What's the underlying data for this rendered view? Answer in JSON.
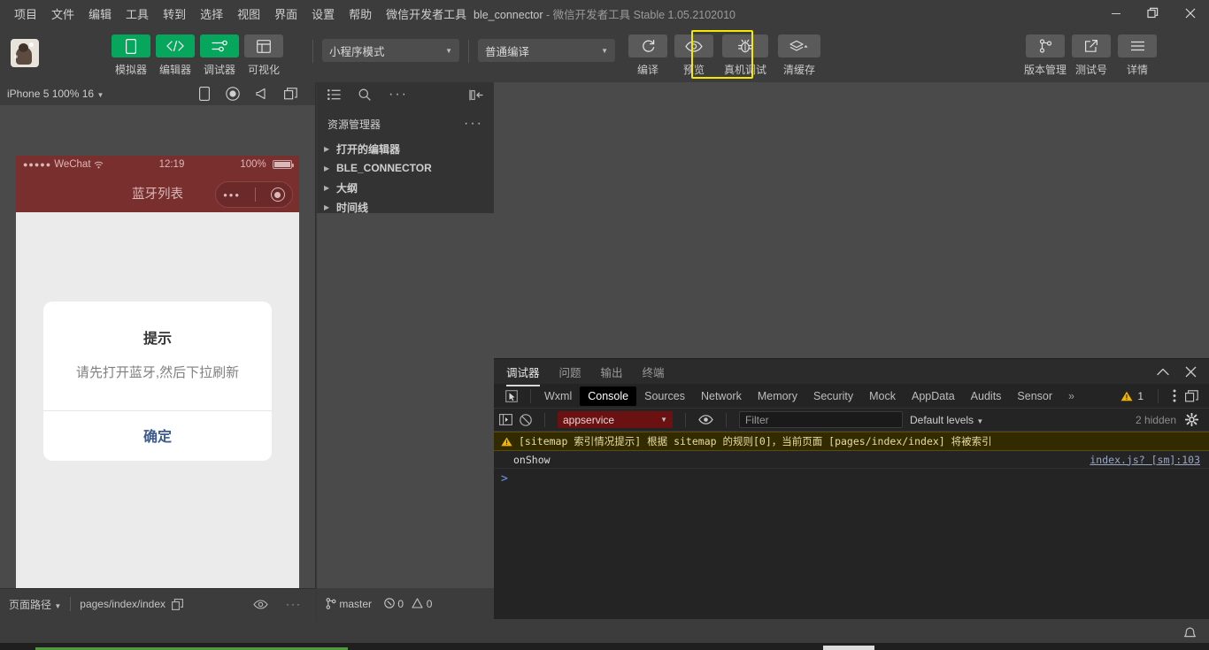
{
  "titlebar": {
    "menus": [
      "项目",
      "文件",
      "编辑",
      "工具",
      "转到",
      "选择",
      "视图",
      "界面",
      "设置",
      "帮助",
      "微信开发者工具"
    ],
    "project_name": "ble_connector",
    "title_suffix": " - 微信开发者工具 Stable 1.05.2102010",
    "window_controls": [
      "minimize-icon",
      "restore-icon",
      "close-icon"
    ]
  },
  "toolbar": {
    "left_buttons": [
      {
        "label": "模拟器",
        "icon": "phone-icon",
        "active": true
      },
      {
        "label": "编辑器",
        "icon": "code-icon",
        "active": true
      },
      {
        "label": "调试器",
        "icon": "sliders-icon",
        "active": true
      },
      {
        "label": "可视化",
        "icon": "layout-icon",
        "active": false
      }
    ],
    "mode_select": "小程序模式",
    "compile_select": "普通编译",
    "mid_buttons": [
      {
        "label": "编译",
        "icon": "refresh-icon",
        "highlighted": false
      },
      {
        "label": "预览",
        "icon": "eye-icon",
        "highlighted": false
      },
      {
        "label": "真机调试",
        "icon": "bug-icon",
        "highlighted": true
      },
      {
        "label": "清缓存",
        "icon": "layers-icon",
        "highlighted": false
      }
    ],
    "right_buttons": [
      {
        "label": "版本管理",
        "icon": "branch-icon"
      },
      {
        "label": "测试号",
        "icon": "external-link-icon"
      },
      {
        "label": "详情",
        "icon": "hamburger-icon"
      }
    ],
    "highlight_color": "#f5e900",
    "accent_green": "#07a65d"
  },
  "simulator": {
    "device": "iPhone 5 100% 16",
    "head_icons": [
      "rotate-device-icon",
      "record-icon",
      "volume-icon",
      "multi-window-icon"
    ],
    "phone": {
      "carrier": "WeChat",
      "signal_dots": "●●●●●",
      "wifi": "wifi-icon",
      "time": "12:19",
      "battery_percent": "100%",
      "nav_title": "蓝牙列表",
      "capsule_dots": "•••",
      "nav_bg": "#7a2f2f"
    },
    "modal": {
      "title": "提示",
      "text": "请先打开蓝牙,然后下拉刷新",
      "confirm": "确定",
      "confirm_color": "#3d5a91"
    },
    "footer": {
      "path_label": "页面路径",
      "path_value": "pages/index/index",
      "copy_icon": "copy-icon",
      "eye_icon": "eye-icon",
      "more_icon": "more-icon"
    }
  },
  "explorer": {
    "toolbar_icons": [
      "list-icon",
      "search-icon",
      "more-icon",
      "collapse-panel-icon"
    ],
    "title": "资源管理器",
    "title_more": "more-icon",
    "tree": [
      "打开的编辑器",
      "BLE_CONNECTOR",
      "大纲",
      "时间线"
    ],
    "footer": {
      "branch_icon": "branch-icon",
      "branch": "master",
      "error_icon": "error-circle-icon",
      "errors": "0",
      "warn_icon": "warning-triangle-icon",
      "warnings": "0"
    }
  },
  "devtools": {
    "panel_tabs": [
      {
        "label": "调试器",
        "active": true
      },
      {
        "label": "问题",
        "active": false
      },
      {
        "label": "输出",
        "active": false
      },
      {
        "label": "终端",
        "active": false
      }
    ],
    "panel_actions": [
      "chevron-up-icon",
      "close-icon"
    ],
    "sub_tabs": [
      {
        "label": "Wxml",
        "active": false
      },
      {
        "label": "Console",
        "active": true
      },
      {
        "label": "Sources",
        "active": false
      },
      {
        "label": "Network",
        "active": false
      },
      {
        "label": "Memory",
        "active": false
      },
      {
        "label": "Security",
        "active": false
      },
      {
        "label": "Mock",
        "active": false
      },
      {
        "label": "AppData",
        "active": false
      },
      {
        "label": "Audits",
        "active": false
      },
      {
        "label": "Sensor",
        "active": false
      }
    ],
    "overflow": "»",
    "inspect_icon": "inspect-element-icon",
    "warning_badge_count": "1",
    "dots_menu_icon": "vertical-dots-icon",
    "dock_icon": "dock-panel-icon",
    "console_bar": {
      "sidebar_icon": "console-sidebar-icon",
      "clear_icon": "clear-console-icon",
      "context": "appservice",
      "context_bg": "#6b1111",
      "eye_icon": "live-expression-icon",
      "filter_placeholder": "Filter",
      "filter_value": "",
      "levels": "Default levels",
      "hidden_text": "2 hidden",
      "settings_icon": "gear-icon"
    },
    "logs": [
      {
        "type": "warning",
        "icon": "warning-triangle-icon",
        "text": "[sitemap 索引情况提示] 根据 sitemap 的规则[0]，当前页面 [pages/index/index] 将被索引",
        "source": ""
      },
      {
        "type": "info",
        "icon": "",
        "text": "onShow",
        "source": "index.js? [sm]:103"
      }
    ],
    "prompt": ">"
  },
  "statusbar": {
    "bell_icon": "bell-icon"
  }
}
